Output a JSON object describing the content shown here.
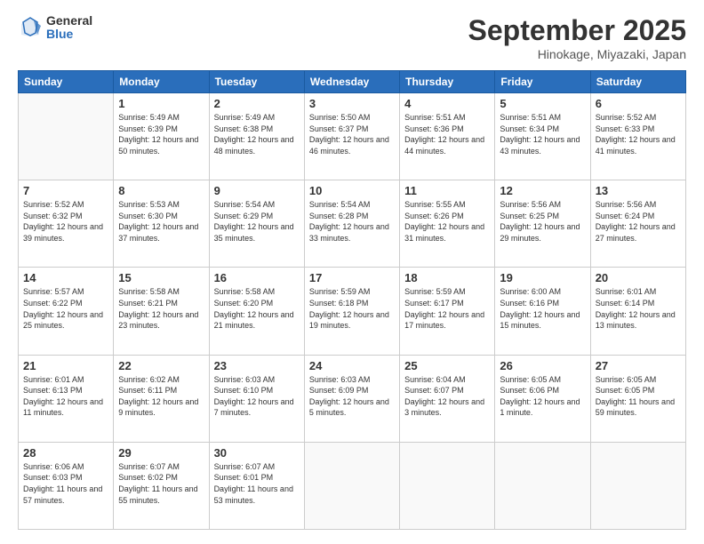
{
  "logo": {
    "general": "General",
    "blue": "Blue"
  },
  "header": {
    "month": "September 2025",
    "location": "Hinokage, Miyazaki, Japan"
  },
  "weekdays": [
    "Sunday",
    "Monday",
    "Tuesday",
    "Wednesday",
    "Thursday",
    "Friday",
    "Saturday"
  ],
  "weeks": [
    [
      {
        "day": "",
        "empty": true
      },
      {
        "day": "1",
        "sunrise": "5:49 AM",
        "sunset": "6:39 PM",
        "daylight": "12 hours and 50 minutes."
      },
      {
        "day": "2",
        "sunrise": "5:49 AM",
        "sunset": "6:38 PM",
        "daylight": "12 hours and 48 minutes."
      },
      {
        "day": "3",
        "sunrise": "5:50 AM",
        "sunset": "6:37 PM",
        "daylight": "12 hours and 46 minutes."
      },
      {
        "day": "4",
        "sunrise": "5:51 AM",
        "sunset": "6:36 PM",
        "daylight": "12 hours and 44 minutes."
      },
      {
        "day": "5",
        "sunrise": "5:51 AM",
        "sunset": "6:34 PM",
        "daylight": "12 hours and 43 minutes."
      },
      {
        "day": "6",
        "sunrise": "5:52 AM",
        "sunset": "6:33 PM",
        "daylight": "12 hours and 41 minutes."
      }
    ],
    [
      {
        "day": "7",
        "sunrise": "5:52 AM",
        "sunset": "6:32 PM",
        "daylight": "12 hours and 39 minutes."
      },
      {
        "day": "8",
        "sunrise": "5:53 AM",
        "sunset": "6:30 PM",
        "daylight": "12 hours and 37 minutes."
      },
      {
        "day": "9",
        "sunrise": "5:54 AM",
        "sunset": "6:29 PM",
        "daylight": "12 hours and 35 minutes."
      },
      {
        "day": "10",
        "sunrise": "5:54 AM",
        "sunset": "6:28 PM",
        "daylight": "12 hours and 33 minutes."
      },
      {
        "day": "11",
        "sunrise": "5:55 AM",
        "sunset": "6:26 PM",
        "daylight": "12 hours and 31 minutes."
      },
      {
        "day": "12",
        "sunrise": "5:56 AM",
        "sunset": "6:25 PM",
        "daylight": "12 hours and 29 minutes."
      },
      {
        "day": "13",
        "sunrise": "5:56 AM",
        "sunset": "6:24 PM",
        "daylight": "12 hours and 27 minutes."
      }
    ],
    [
      {
        "day": "14",
        "sunrise": "5:57 AM",
        "sunset": "6:22 PM",
        "daylight": "12 hours and 25 minutes."
      },
      {
        "day": "15",
        "sunrise": "5:58 AM",
        "sunset": "6:21 PM",
        "daylight": "12 hours and 23 minutes."
      },
      {
        "day": "16",
        "sunrise": "5:58 AM",
        "sunset": "6:20 PM",
        "daylight": "12 hours and 21 minutes."
      },
      {
        "day": "17",
        "sunrise": "5:59 AM",
        "sunset": "6:18 PM",
        "daylight": "12 hours and 19 minutes."
      },
      {
        "day": "18",
        "sunrise": "5:59 AM",
        "sunset": "6:17 PM",
        "daylight": "12 hours and 17 minutes."
      },
      {
        "day": "19",
        "sunrise": "6:00 AM",
        "sunset": "6:16 PM",
        "daylight": "12 hours and 15 minutes."
      },
      {
        "day": "20",
        "sunrise": "6:01 AM",
        "sunset": "6:14 PM",
        "daylight": "12 hours and 13 minutes."
      }
    ],
    [
      {
        "day": "21",
        "sunrise": "6:01 AM",
        "sunset": "6:13 PM",
        "daylight": "12 hours and 11 minutes."
      },
      {
        "day": "22",
        "sunrise": "6:02 AM",
        "sunset": "6:11 PM",
        "daylight": "12 hours and 9 minutes."
      },
      {
        "day": "23",
        "sunrise": "6:03 AM",
        "sunset": "6:10 PM",
        "daylight": "12 hours and 7 minutes."
      },
      {
        "day": "24",
        "sunrise": "6:03 AM",
        "sunset": "6:09 PM",
        "daylight": "12 hours and 5 minutes."
      },
      {
        "day": "25",
        "sunrise": "6:04 AM",
        "sunset": "6:07 PM",
        "daylight": "12 hours and 3 minutes."
      },
      {
        "day": "26",
        "sunrise": "6:05 AM",
        "sunset": "6:06 PM",
        "daylight": "12 hours and 1 minute."
      },
      {
        "day": "27",
        "sunrise": "6:05 AM",
        "sunset": "6:05 PM",
        "daylight": "11 hours and 59 minutes."
      }
    ],
    [
      {
        "day": "28",
        "sunrise": "6:06 AM",
        "sunset": "6:03 PM",
        "daylight": "11 hours and 57 minutes."
      },
      {
        "day": "29",
        "sunrise": "6:07 AM",
        "sunset": "6:02 PM",
        "daylight": "11 hours and 55 minutes."
      },
      {
        "day": "30",
        "sunrise": "6:07 AM",
        "sunset": "6:01 PM",
        "daylight": "11 hours and 53 minutes."
      },
      {
        "day": "",
        "empty": true
      },
      {
        "day": "",
        "empty": true
      },
      {
        "day": "",
        "empty": true
      },
      {
        "day": "",
        "empty": true
      }
    ]
  ]
}
